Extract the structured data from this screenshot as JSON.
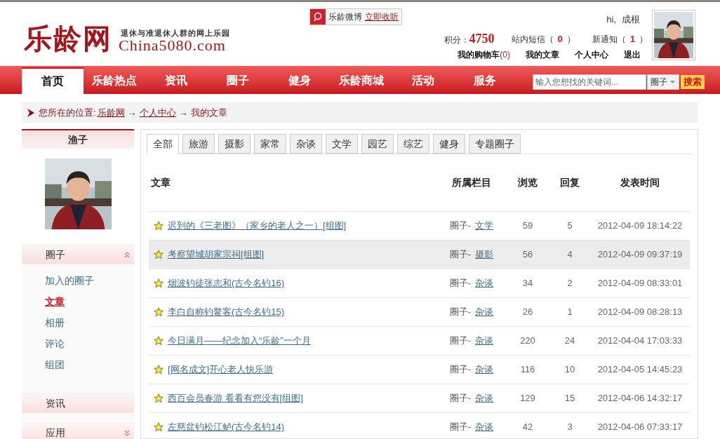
{
  "header": {
    "logo_text": "乐龄网",
    "slogan": "退休与准退休人群的网上乐园",
    "domain": "China5080.com",
    "weibo": {
      "label": "乐龄微博",
      "action": "立即收听"
    },
    "greeting": {
      "hi": "hi,",
      "user": "成根"
    },
    "stats": [
      {
        "label": "积分：",
        "value": "4750",
        "kind": "points"
      },
      {
        "label": "站内短信（",
        "value": "0",
        "suffix": "）",
        "kind": "count"
      },
      {
        "label": "新通知（",
        "value": "1",
        "suffix": "）",
        "kind": "count"
      }
    ],
    "links": [
      {
        "label": "我的购物车",
        "count": "(0)"
      },
      {
        "label": "我的文章"
      },
      {
        "label": "个人中心"
      },
      {
        "label": "退出"
      }
    ]
  },
  "nav": {
    "items": [
      {
        "label": "首页",
        "selected": true
      },
      {
        "label": "乐龄热点",
        "selected": false
      },
      {
        "label": "资讯",
        "selected": false
      },
      {
        "label": "圈子",
        "selected": false
      },
      {
        "label": "健身",
        "selected": false
      },
      {
        "label": "乐龄商城",
        "selected": false
      },
      {
        "label": "活动",
        "selected": false
      },
      {
        "label": "服务",
        "selected": false
      }
    ],
    "search": {
      "placeholder": "输入您想找的关键词...",
      "scope": "圈子",
      "button": "搜索"
    }
  },
  "breadcrumb": {
    "prefix": "您所在的位置:",
    "path": [
      {
        "label": "乐龄网",
        "link": true
      },
      {
        "label": "个人中心",
        "link": true
      },
      {
        "label": "我的文章",
        "link": false
      }
    ],
    "separator": "→"
  },
  "sidebar": {
    "username": "渔子",
    "sections": [
      {
        "title": "圈子",
        "expanded": true,
        "items": [
          {
            "label": "加入的圈子",
            "selected": false
          },
          {
            "label": "文章",
            "selected": true
          },
          {
            "label": "相册",
            "selected": false
          },
          {
            "label": "评论",
            "selected": false
          },
          {
            "label": "组团",
            "selected": false
          }
        ]
      },
      {
        "title": "资讯"
      },
      {
        "title": "应用",
        "expanded": false
      }
    ]
  },
  "tabs": [
    {
      "label": "全部",
      "selected": true
    },
    {
      "label": "旅游",
      "selected": false
    },
    {
      "label": "摄影",
      "selected": false
    },
    {
      "label": "家常",
      "selected": false
    },
    {
      "label": "杂谈",
      "selected": false
    },
    {
      "label": "文学",
      "selected": false
    },
    {
      "label": "园艺",
      "selected": false
    },
    {
      "label": "综艺",
      "selected": false
    },
    {
      "label": "健身",
      "selected": false
    },
    {
      "label": "专题圈子",
      "selected": false
    }
  ],
  "table": {
    "columns": [
      "文章",
      "所属栏目",
      "浏览",
      "回复",
      "发表时间"
    ],
    "rows": [
      {
        "title": "迟到的《三老图》（家乡的老人之一）[组图]",
        "group": "圈子-",
        "category": "文学",
        "views": "59",
        "replies": "5",
        "time": "2012-04-09 18:14:22",
        "highlighted": false
      },
      {
        "title": "考察望城胡家宗祠[组图]",
        "group": "圈子-",
        "category": "摄影",
        "views": "56",
        "replies": "4",
        "time": "2012-04-09 09:37:19",
        "highlighted": true
      },
      {
        "title": "烟波钓徒张志和(古今名钓16)",
        "group": "圈子-",
        "category": "杂谈",
        "views": "34",
        "replies": "2",
        "time": "2012-04-09 08:33:01",
        "highlighted": false
      },
      {
        "title": "李白自称钓鳌客(古今名钓15)",
        "group": "圈子-",
        "category": "杂谈",
        "views": "26",
        "replies": "1",
        "time": "2012-04-09 08:28:13",
        "highlighted": false
      },
      {
        "title": "今日满月——纪念加入“乐龄”一个月",
        "group": "圈子-",
        "category": "杂谈",
        "views": "220",
        "replies": "24",
        "time": "2012-04-04 17:03:33",
        "highlighted": false
      },
      {
        "title": "[网名成文]开心老人快乐游",
        "group": "圈子-",
        "category": "杂谈",
        "views": "116",
        "replies": "10",
        "time": "2012-04-05 14:45:23",
        "highlighted": false
      },
      {
        "title": "西百会员春游 看看有您没有[组图]",
        "group": "圈子-",
        "category": "杂谈",
        "views": "129",
        "replies": "15",
        "time": "2012-04-06 14:32:17",
        "highlighted": false
      },
      {
        "title": "左慈盆钓松江鲈(古今名钓14)",
        "group": "圈子-",
        "category": "杂谈",
        "views": "42",
        "replies": "3",
        "time": "2012-04-06 07:33:17",
        "highlighted": false
      }
    ]
  }
}
